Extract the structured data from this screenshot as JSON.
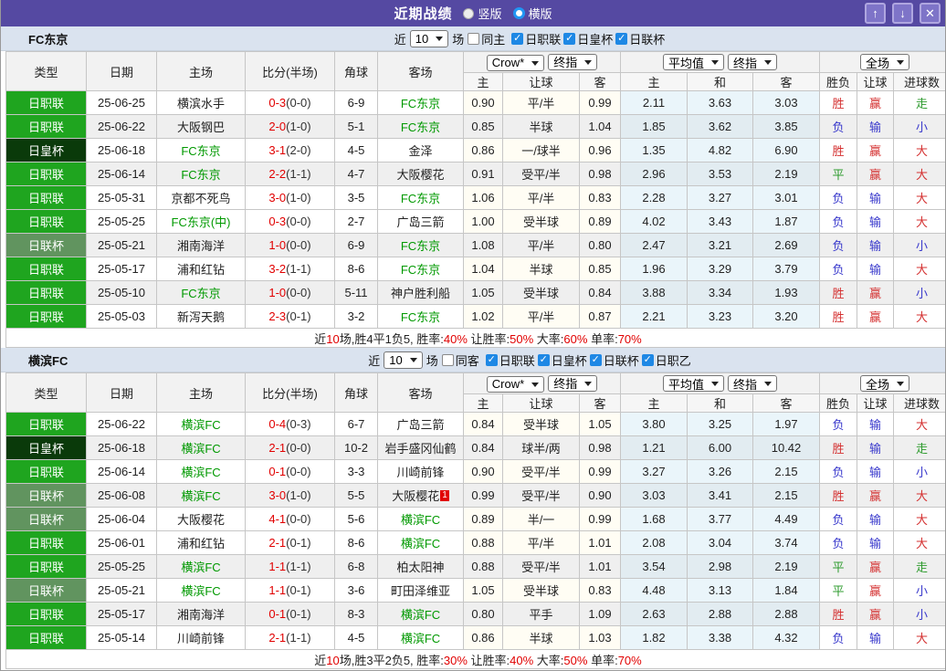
{
  "colors": {
    "titlebar": "#5549A2",
    "btn": "#7E74C8",
    "btnborder": "#AFA6E0",
    "bar": "#DAE3EF",
    "check": "#1E88E5",
    "j1": "#1FA51F",
    "emp": "#0A3A0A",
    "lc": "#61945F",
    "teamgreen": "#009900",
    "scorered": "#E10000",
    "resr": "#D43030",
    "resb": "#3939CC",
    "resg": "#2E9B2E"
  },
  "icons": {
    "check": "✓"
  },
  "title_bar": {
    "title": "近期战绩",
    "vertical": "竖版",
    "horizontal": "横版",
    "up_icon": "↑",
    "down_icon": "↓",
    "close_icon": "✕"
  },
  "table_columns": {
    "left": [
      "类型",
      "日期",
      "主场",
      "比分(半场)",
      "角球",
      "客场"
    ],
    "right": [
      "主",
      "让球",
      "客",
      "主",
      "和",
      "客",
      "胜负",
      "让球",
      "进球数"
    ]
  },
  "sections": [
    {
      "team": "FC东京",
      "filter": {
        "near": "近",
        "count": "10",
        "games": "场",
        "same": "同主",
        "leagues": [
          "日职联",
          "日皇杯",
          "日联杯"
        ]
      },
      "selects": {
        "group1": [
          "Crow*",
          "终指"
        ],
        "group2": [
          "平均值",
          "终指"
        ],
        "group3": [
          "全场"
        ]
      },
      "rows": [
        {
          "lg": "日职联",
          "lgc": "j1",
          "date": "25-06-25",
          "home": "横滨水手",
          "hg": false,
          "score": "0-3",
          "half": "(0-0)",
          "corner": "6-9",
          "away": "FC东京",
          "ag": true,
          "rc": "",
          "o1": "0.90",
          "h": "平/半",
          "o2": "0.99",
          "m1": "2.11",
          "m2": "3.63",
          "m3": "3.03",
          "r1": "胜",
          "c1": "r",
          "r2": "赢",
          "c2": "r",
          "r3": "走",
          "c3": "g"
        },
        {
          "lg": "日职联",
          "lgc": "j1",
          "date": "25-06-22",
          "home": "大阪钢巴",
          "hg": false,
          "score": "2-0",
          "half": "(1-0)",
          "corner": "5-1",
          "away": "FC东京",
          "ag": true,
          "rc": "",
          "o1": "0.85",
          "h": "半球",
          "o2": "1.04",
          "m1": "1.85",
          "m2": "3.62",
          "m3": "3.85",
          "r1": "负",
          "c1": "b",
          "r2": "输",
          "c2": "b",
          "r3": "小",
          "c3": "b"
        },
        {
          "lg": "日皇杯",
          "lgc": "emp",
          "date": "25-06-18",
          "home": "FC东京",
          "hg": true,
          "score": "3-1",
          "half": "(2-0)",
          "corner": "4-5",
          "away": "金泽",
          "ag": false,
          "rc": "",
          "o1": "0.86",
          "h": "一/球半",
          "o2": "0.96",
          "m1": "1.35",
          "m2": "4.82",
          "m3": "6.90",
          "r1": "胜",
          "c1": "r",
          "r2": "赢",
          "c2": "r",
          "r3": "大",
          "c3": "r"
        },
        {
          "lg": "日职联",
          "lgc": "j1",
          "date": "25-06-14",
          "home": "FC东京",
          "hg": true,
          "score": "2-2",
          "half": "(1-1)",
          "corner": "4-7",
          "away": "大阪樱花",
          "ag": false,
          "rc": "",
          "o1": "0.91",
          "h": "受平/半",
          "o2": "0.98",
          "m1": "2.96",
          "m2": "3.53",
          "m3": "2.19",
          "r1": "平",
          "c1": "g",
          "r2": "赢",
          "c2": "r",
          "r3": "大",
          "c3": "r"
        },
        {
          "lg": "日职联",
          "lgc": "j1",
          "date": "25-05-31",
          "home": "京都不死鸟",
          "hg": false,
          "score": "3-0",
          "half": "(1-0)",
          "corner": "3-5",
          "away": "FC东京",
          "ag": true,
          "rc": "",
          "o1": "1.06",
          "h": "平/半",
          "o2": "0.83",
          "m1": "2.28",
          "m2": "3.27",
          "m3": "3.01",
          "r1": "负",
          "c1": "b",
          "r2": "输",
          "c2": "b",
          "r3": "大",
          "c3": "r"
        },
        {
          "lg": "日职联",
          "lgc": "j1",
          "date": "25-05-25",
          "home": "FC东京(中)",
          "hg": true,
          "score": "0-3",
          "half": "(0-0)",
          "corner": "2-7",
          "away": "广岛三箭",
          "ag": false,
          "rc": "",
          "o1": "1.00",
          "h": "受半球",
          "o2": "0.89",
          "m1": "4.02",
          "m2": "3.43",
          "m3": "1.87",
          "r1": "负",
          "c1": "b",
          "r2": "输",
          "c2": "b",
          "r3": "大",
          "c3": "r"
        },
        {
          "lg": "日联杯",
          "lgc": "lc",
          "date": "25-05-21",
          "home": "湘南海洋",
          "hg": false,
          "score": "1-0",
          "half": "(0-0)",
          "corner": "6-9",
          "away": "FC东京",
          "ag": true,
          "rc": "",
          "o1": "1.08",
          "h": "平/半",
          "o2": "0.80",
          "m1": "2.47",
          "m2": "3.21",
          "m3": "2.69",
          "r1": "负",
          "c1": "b",
          "r2": "输",
          "c2": "b",
          "r3": "小",
          "c3": "b"
        },
        {
          "lg": "日职联",
          "lgc": "j1",
          "date": "25-05-17",
          "home": "浦和红钻",
          "hg": false,
          "score": "3-2",
          "half": "(1-1)",
          "corner": "8-6",
          "away": "FC东京",
          "ag": true,
          "rc": "",
          "o1": "1.04",
          "h": "半球",
          "o2": "0.85",
          "m1": "1.96",
          "m2": "3.29",
          "m3": "3.79",
          "r1": "负",
          "c1": "b",
          "r2": "输",
          "c2": "b",
          "r3": "大",
          "c3": "r"
        },
        {
          "lg": "日职联",
          "lgc": "j1",
          "date": "25-05-10",
          "home": "FC东京",
          "hg": true,
          "score": "1-0",
          "half": "(0-0)",
          "corner": "5-11",
          "away": "神户胜利船",
          "ag": false,
          "rc": "",
          "o1": "1.05",
          "h": "受半球",
          "o2": "0.84",
          "m1": "3.88",
          "m2": "3.34",
          "m3": "1.93",
          "r1": "胜",
          "c1": "r",
          "r2": "赢",
          "c2": "r",
          "r3": "小",
          "c3": "b"
        },
        {
          "lg": "日职联",
          "lgc": "j1",
          "date": "25-05-03",
          "home": "新泻天鹅",
          "hg": false,
          "score": "2-3",
          "half": "(0-1)",
          "corner": "3-2",
          "away": "FC东京",
          "ag": true,
          "rc": "",
          "o1": "1.02",
          "h": "平/半",
          "o2": "0.87",
          "m1": "2.21",
          "m2": "3.23",
          "m3": "3.20",
          "r1": "胜",
          "c1": "r",
          "r2": "赢",
          "c2": "r",
          "r3": "大",
          "c3": "r"
        }
      ],
      "summary": [
        {
          "t": "近"
        },
        {
          "t": "10",
          "red": true
        },
        {
          "t": "场,胜4平1负5, 胜率:"
        },
        {
          "t": "40%",
          "red": true
        },
        {
          "t": " 让胜率:"
        },
        {
          "t": "50%",
          "red": true
        },
        {
          "t": " 大率:"
        },
        {
          "t": "60%",
          "red": true
        },
        {
          "t": " 单率:"
        },
        {
          "t": "70%",
          "red": true
        }
      ]
    },
    {
      "team": "横滨FC",
      "filter": {
        "near": "近",
        "count": "10",
        "games": "场",
        "same": "同客",
        "leagues": [
          "日职联",
          "日皇杯",
          "日联杯",
          "日职乙"
        ]
      },
      "selects": {
        "group1": [
          "Crow*",
          "终指"
        ],
        "group2": [
          "平均值",
          "终指"
        ],
        "group3": [
          "全场"
        ]
      },
      "rows": [
        {
          "lg": "日职联",
          "lgc": "j1",
          "date": "25-06-22",
          "home": "横滨FC",
          "hg": true,
          "score": "0-4",
          "half": "(0-3)",
          "corner": "6-7",
          "away": "广岛三箭",
          "ag": false,
          "rc": "",
          "o1": "0.84",
          "h": "受半球",
          "o2": "1.05",
          "m1": "3.80",
          "m2": "3.25",
          "m3": "1.97",
          "r1": "负",
          "c1": "b",
          "r2": "输",
          "c2": "b",
          "r3": "大",
          "c3": "r"
        },
        {
          "lg": "日皇杯",
          "lgc": "emp",
          "date": "25-06-18",
          "home": "横滨FC",
          "hg": true,
          "score": "2-1",
          "half": "(0-0)",
          "corner": "10-2",
          "away": "岩手盛冈仙鹤",
          "ag": false,
          "rc": "",
          "o1": "0.84",
          "h": "球半/两",
          "o2": "0.98",
          "m1": "1.21",
          "m2": "6.00",
          "m3": "10.42",
          "r1": "胜",
          "c1": "r",
          "r2": "输",
          "c2": "b",
          "r3": "走",
          "c3": "g"
        },
        {
          "lg": "日职联",
          "lgc": "j1",
          "date": "25-06-14",
          "home": "横滨FC",
          "hg": true,
          "score": "0-1",
          "half": "(0-0)",
          "corner": "3-3",
          "away": "川崎前锋",
          "ag": false,
          "rc": "",
          "o1": "0.90",
          "h": "受平/半",
          "o2": "0.99",
          "m1": "3.27",
          "m2": "3.26",
          "m3": "2.15",
          "r1": "负",
          "c1": "b",
          "r2": "输",
          "c2": "b",
          "r3": "小",
          "c3": "b"
        },
        {
          "lg": "日联杯",
          "lgc": "lc",
          "date": "25-06-08",
          "home": "横滨FC",
          "hg": true,
          "score": "3-0",
          "half": "(1-0)",
          "corner": "5-5",
          "away": "大阪樱花",
          "ag": false,
          "rc": "1",
          "o1": "0.99",
          "h": "受平/半",
          "o2": "0.90",
          "m1": "3.03",
          "m2": "3.41",
          "m3": "2.15",
          "r1": "胜",
          "c1": "r",
          "r2": "赢",
          "c2": "r",
          "r3": "大",
          "c3": "r"
        },
        {
          "lg": "日联杯",
          "lgc": "lc",
          "date": "25-06-04",
          "home": "大阪樱花",
          "hg": false,
          "score": "4-1",
          "half": "(0-0)",
          "corner": "5-6",
          "away": "横滨FC",
          "ag": true,
          "rc": "",
          "o1": "0.89",
          "h": "半/一",
          "o2": "0.99",
          "m1": "1.68",
          "m2": "3.77",
          "m3": "4.49",
          "r1": "负",
          "c1": "b",
          "r2": "输",
          "c2": "b",
          "r3": "大",
          "c3": "r"
        },
        {
          "lg": "日职联",
          "lgc": "j1",
          "date": "25-06-01",
          "home": "浦和红钻",
          "hg": false,
          "score": "2-1",
          "half": "(0-1)",
          "corner": "8-6",
          "away": "横滨FC",
          "ag": true,
          "rc": "",
          "o1": "0.88",
          "h": "平/半",
          "o2": "1.01",
          "m1": "2.08",
          "m2": "3.04",
          "m3": "3.74",
          "r1": "负",
          "c1": "b",
          "r2": "输",
          "c2": "b",
          "r3": "大",
          "c3": "r"
        },
        {
          "lg": "日职联",
          "lgc": "j1",
          "date": "25-05-25",
          "home": "横滨FC",
          "hg": true,
          "score": "1-1",
          "half": "(1-1)",
          "corner": "6-8",
          "away": "柏太阳神",
          "ag": false,
          "rc": "",
          "o1": "0.88",
          "h": "受平/半",
          "o2": "1.01",
          "m1": "3.54",
          "m2": "2.98",
          "m3": "2.19",
          "r1": "平",
          "c1": "g",
          "r2": "赢",
          "c2": "r",
          "r3": "走",
          "c3": "g"
        },
        {
          "lg": "日联杯",
          "lgc": "lc",
          "date": "25-05-21",
          "home": "横滨FC",
          "hg": true,
          "score": "1-1",
          "half": "(0-1)",
          "corner": "3-6",
          "away": "町田泽维亚",
          "ag": false,
          "rc": "",
          "o1": "1.05",
          "h": "受半球",
          "o2": "0.83",
          "m1": "4.48",
          "m2": "3.13",
          "m3": "1.84",
          "r1": "平",
          "c1": "g",
          "r2": "赢",
          "c2": "r",
          "r3": "小",
          "c3": "b"
        },
        {
          "lg": "日职联",
          "lgc": "j1",
          "date": "25-05-17",
          "home": "湘南海洋",
          "hg": false,
          "score": "0-1",
          "half": "(0-1)",
          "corner": "8-3",
          "away": "横滨FC",
          "ag": true,
          "rc": "",
          "o1": "0.80",
          "h": "平手",
          "o2": "1.09",
          "m1": "2.63",
          "m2": "2.88",
          "m3": "2.88",
          "r1": "胜",
          "c1": "r",
          "r2": "赢",
          "c2": "r",
          "r3": "小",
          "c3": "b"
        },
        {
          "lg": "日职联",
          "lgc": "j1",
          "date": "25-05-14",
          "home": "川崎前锋",
          "hg": false,
          "score": "2-1",
          "half": "(1-1)",
          "corner": "4-5",
          "away": "横滨FC",
          "ag": true,
          "rc": "",
          "o1": "0.86",
          "h": "半球",
          "o2": "1.03",
          "m1": "1.82",
          "m2": "3.38",
          "m3": "4.32",
          "r1": "负",
          "c1": "b",
          "r2": "输",
          "c2": "b",
          "r3": "大",
          "c3": "r"
        }
      ],
      "summary": [
        {
          "t": "近"
        },
        {
          "t": "10",
          "red": true
        },
        {
          "t": "场,胜3平2负5, 胜率:"
        },
        {
          "t": "30%",
          "red": true
        },
        {
          "t": " 让胜率:"
        },
        {
          "t": "40%",
          "red": true
        },
        {
          "t": " 大率:"
        },
        {
          "t": "50%",
          "red": true
        },
        {
          "t": " 单率:"
        },
        {
          "t": "70%",
          "red": true
        }
      ]
    }
  ]
}
